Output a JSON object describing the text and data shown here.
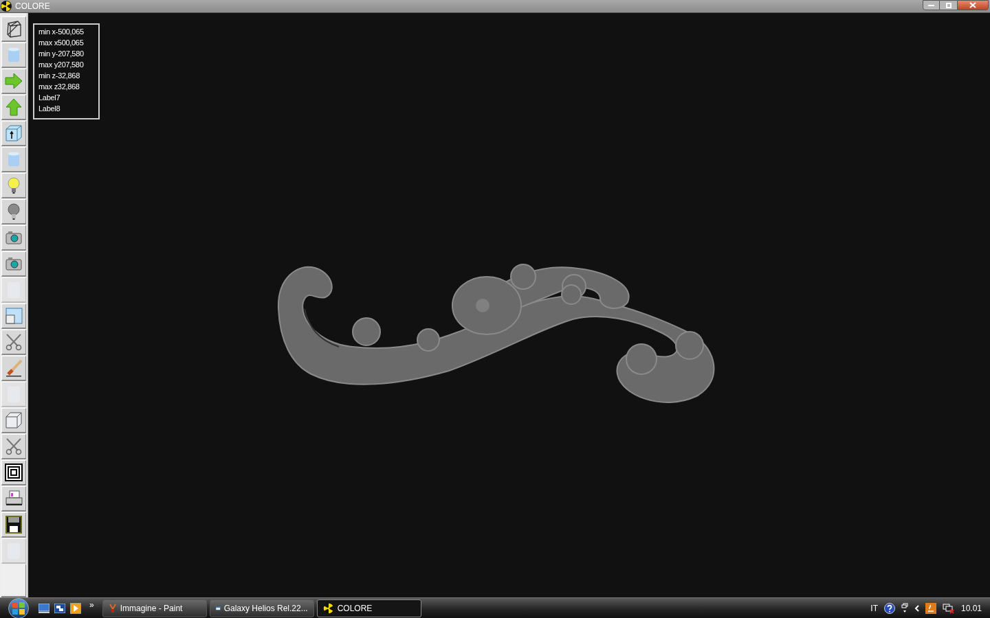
{
  "window": {
    "title": "COLORE"
  },
  "toolbar": [
    {
      "kind": "wireframe",
      "disabled": false
    },
    {
      "kind": "cylinder",
      "disabled": false
    },
    {
      "kind": "arrow-right",
      "disabled": false
    },
    {
      "kind": "arrow-up",
      "disabled": false
    },
    {
      "kind": "box-arrow",
      "disabled": false
    },
    {
      "kind": "cylinder",
      "disabled": false
    },
    {
      "kind": "bulb-on",
      "disabled": false
    },
    {
      "kind": "bulb-off",
      "disabled": false
    },
    {
      "kind": "camera",
      "disabled": false
    },
    {
      "kind": "camera",
      "disabled": false
    },
    {
      "kind": "blank",
      "disabled": true
    },
    {
      "kind": "window",
      "disabled": false
    },
    {
      "kind": "scissors",
      "disabled": false
    },
    {
      "kind": "brush",
      "disabled": false
    },
    {
      "kind": "blank",
      "disabled": true
    },
    {
      "kind": "cube",
      "disabled": false
    },
    {
      "kind": "scissors",
      "disabled": false
    },
    {
      "kind": "squares",
      "disabled": false
    },
    {
      "kind": "printer",
      "disabled": false
    },
    {
      "kind": "floppy",
      "disabled": false
    },
    {
      "kind": "blank",
      "disabled": true
    }
  ],
  "info_box": [
    "min x-500,065",
    "max x500,065",
    "min y-207,580",
    "max y207,580",
    "min z-32,868",
    "max z32,868",
    "Label7",
    "Label8"
  ],
  "taskbar": {
    "overflow": "»",
    "tasks": [
      {
        "label": "Immagine - Paint",
        "kind": "paint",
        "selected": false
      },
      {
        "label": "Galaxy Helios  Rel.22...",
        "kind": "helios",
        "selected": false
      },
      {
        "label": "COLORE",
        "kind": "colore",
        "selected": true
      }
    ],
    "language": "IT",
    "clock": "10.01"
  }
}
